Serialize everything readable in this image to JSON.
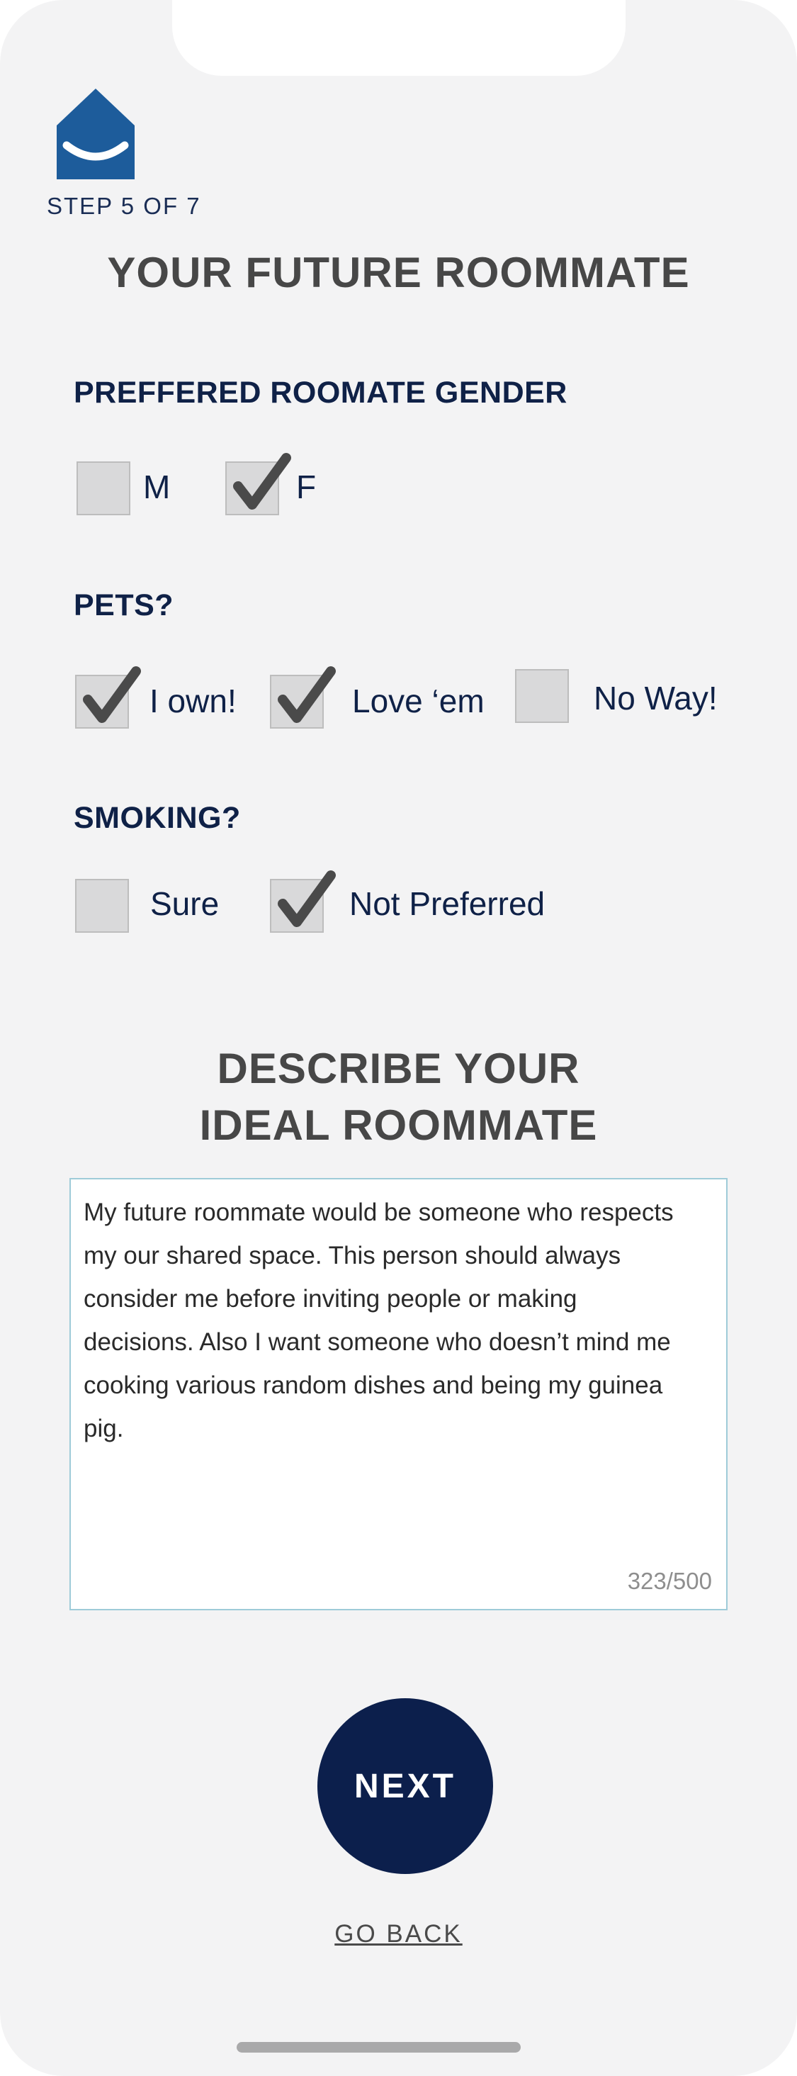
{
  "header": {
    "logo_icon": "house-smile-icon",
    "step_text": "STEP 5 OF 7",
    "title": "YOUR FUTURE ROOMMATE"
  },
  "colors": {
    "brand_blue": "#1d5c9b",
    "navy": "#0c1f4c",
    "heading_gray": "#474747",
    "checkbox_fill": "#d9d9da",
    "check_mark": "#4a4a4a"
  },
  "gender": {
    "label": "PREFFERED ROOMATE GENDER",
    "options": [
      {
        "label": "M",
        "checked": false
      },
      {
        "label": "F",
        "checked": true
      }
    ]
  },
  "pets": {
    "label": "PETS?",
    "options": [
      {
        "label": "I own!",
        "checked": true
      },
      {
        "label": "Love ‘em",
        "checked": true
      },
      {
        "label": "No Way!",
        "checked": false
      }
    ]
  },
  "smoking": {
    "label": "SMOKING?",
    "options": [
      {
        "label": "Sure",
        "checked": false
      },
      {
        "label": "Not Preferred",
        "checked": true
      }
    ]
  },
  "describe": {
    "title_line1": "DESCRIBE YOUR",
    "title_line2": "IDEAL ROOMMATE",
    "text": "My future roommate would be someone who respects my our shared space. This person should always consider me before inviting people or making decisions. Also I want someone who doesn’t mind me cooking various random dishes and being my guinea pig.",
    "counter": "323/500"
  },
  "actions": {
    "next_label": "NEXT",
    "back_label": "GO BACK"
  }
}
